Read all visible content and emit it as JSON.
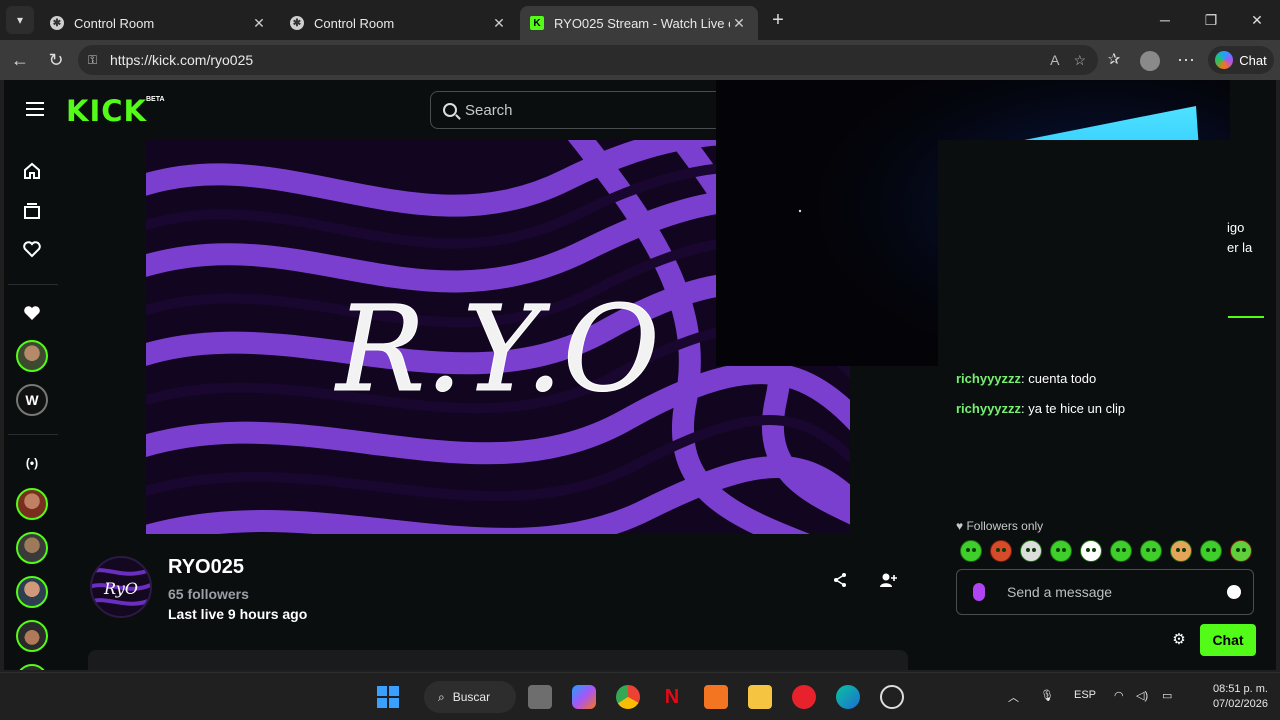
{
  "browser": {
    "tabs": [
      {
        "title": "Control Room",
        "active": false
      },
      {
        "title": "Control Room",
        "active": false
      },
      {
        "title": "RYO025 Stream - Watch Live on Ki",
        "active": true
      }
    ],
    "url": "https://kick.com/ryo025",
    "copilot_label": "Chat"
  },
  "kick": {
    "logo": "KICK",
    "beta": "BETA",
    "search_placeholder": "Search",
    "brand_color": "#53fc18"
  },
  "sidebar": {
    "icons": [
      "home-icon",
      "browse-icon",
      "following-icon",
      "favorite-icon",
      "live-icon"
    ]
  },
  "channel": {
    "name": "RYO025",
    "followers": "65 followers",
    "last_live": "Last live 9 hours ago",
    "banner_text": "R.Y.O",
    "avatar_text": "RyO"
  },
  "chat": {
    "fragments": [
      "igo",
      "er la"
    ],
    "messages": [
      {
        "user": "richyyyzzz",
        "text": ": cuenta todo"
      },
      {
        "user": "richyyyzzz",
        "text": ": ya te hice un clip"
      }
    ],
    "followers_only": "Followers only",
    "input_placeholder": "Send a message",
    "send_label": "Chat"
  },
  "taskbar": {
    "search_label": "Buscar",
    "language": "ESP",
    "time": "08:51 p. m.",
    "date": "07/02/2026"
  }
}
